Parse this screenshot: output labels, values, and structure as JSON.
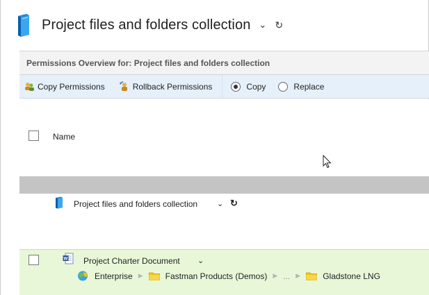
{
  "header": {
    "title": "Project files and folders collection",
    "chevron": "⌄",
    "refresh": "↻"
  },
  "overview": {
    "label": "Permissions Overview for: Project files and folders collection"
  },
  "toolbar": {
    "copy_permissions": "Copy Permissions",
    "rollback_permissions": "Rollback Permissions",
    "mode_options": [
      {
        "label": "Copy",
        "selected": true
      },
      {
        "label": "Replace",
        "selected": false
      }
    ]
  },
  "table": {
    "column_name": "Name",
    "root": {
      "label": "Project files and folders collection",
      "chevron": "⌄",
      "refresh": "↻"
    },
    "rows": [
      {
        "label": "Project Charter Document",
        "chevron": "⌄",
        "path": [
          "Enterprise",
          "Fastman Products (Demos)",
          "...",
          "Gladstone LNG"
        ],
        "path_separator": "▶"
      }
    ]
  },
  "colors": {
    "toolbar_bg": "#e6f0fb",
    "selected_row_bg": "#e9f7d9",
    "band_bg": "#c4c4c4",
    "folder_yellow": "#f0c419"
  }
}
